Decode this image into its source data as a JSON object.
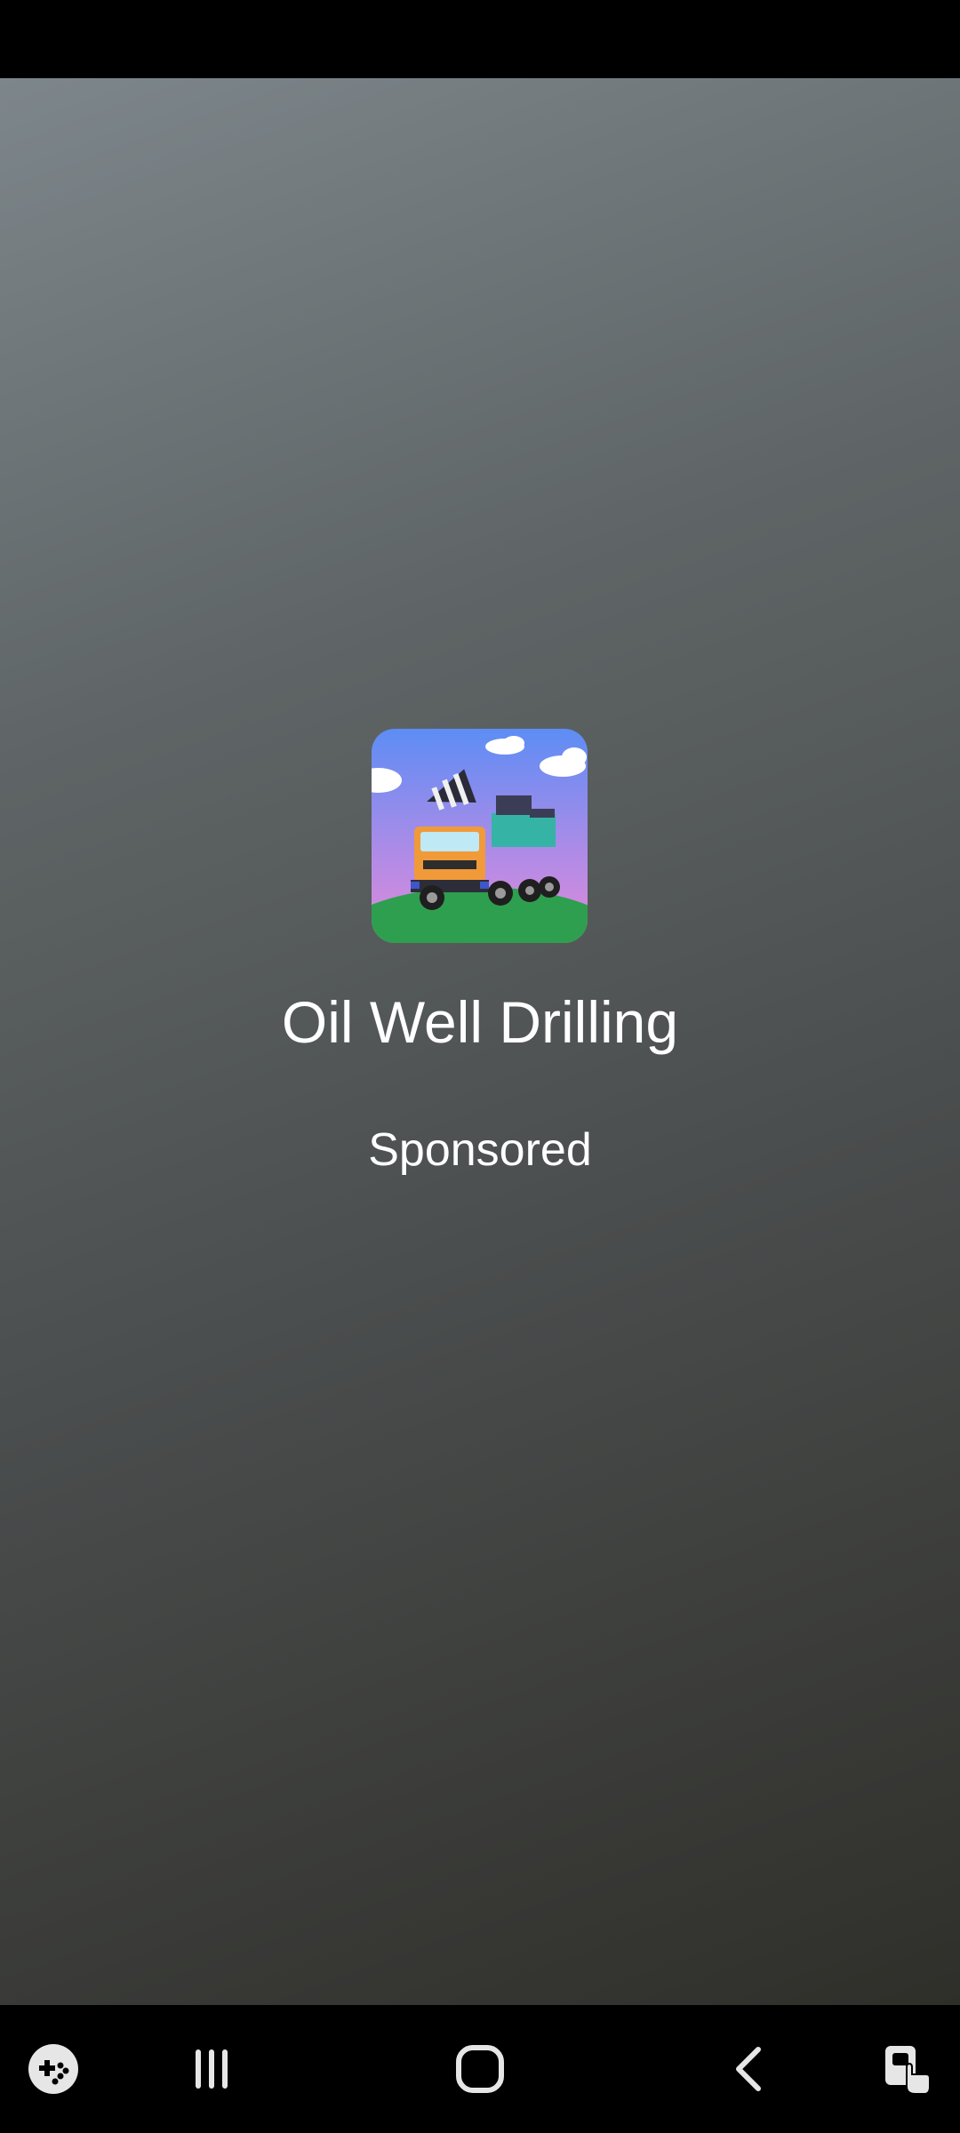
{
  "app": {
    "name": "Oil Well Drilling",
    "sponsored_label": "Sponsored",
    "icon": "oil-drilling-truck-app-icon"
  },
  "nav_bar": {
    "items": [
      {
        "name": "game-tools-icon"
      },
      {
        "name": "recent-apps-icon"
      },
      {
        "name": "home-icon"
      },
      {
        "name": "back-icon"
      },
      {
        "name": "accessibility-touch-icon"
      }
    ]
  },
  "colors": {
    "background_top": "#7d868b",
    "background_bottom": "#2f2f2a",
    "text": "#ffffff",
    "system_bars": "#000000"
  }
}
